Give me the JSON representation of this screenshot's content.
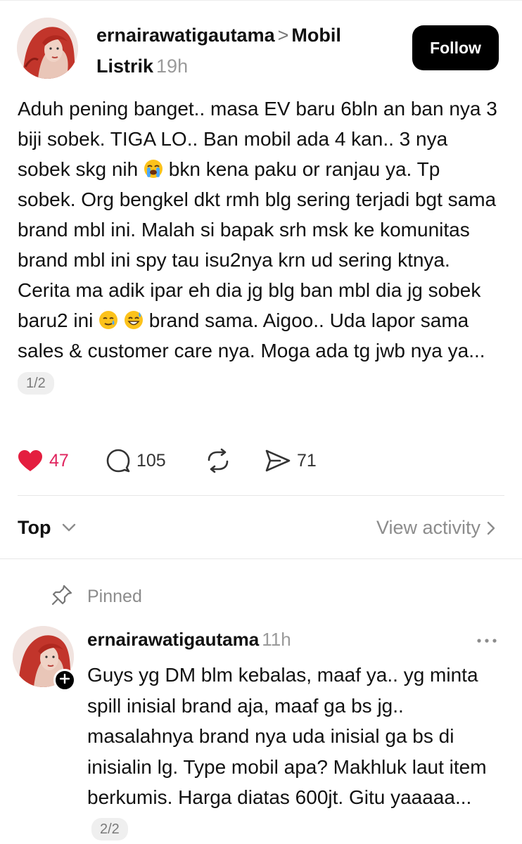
{
  "post": {
    "username": "ernairawatigautama",
    "separator": ">",
    "community": "Mobil Listrik",
    "time": "19h",
    "follow_label": "Follow",
    "body_parts": [
      "Aduh pening banget.. masa EV baru 6bln an ban nya 3 biji sobek. TIGA LO.. Ban mobil ada 4 kan.. 3 nya sobek skg nih ",
      " bkn kena paku or ranjau ya. Tp sobek. Org bengkel dkt rmh blg sering terjadi bgt sama brand mbl ini. Malah si bapak srh msk ke komunitas brand mbl ini spy tau isu2nya krn ud sering ktnya. Cerita ma adik ipar eh dia jg blg ban mbl dia jg sobek baru2 ini ",
      " brand sama. Aigoo.. Uda lapor sama sales & customer care nya. Moga ada tg jwb nya ya..."
    ],
    "emojis": [
      "loudly-crying-face",
      "smiling-face-with-tear",
      "grinning-face-with-sweat"
    ],
    "page_indicator": "1/2",
    "likes": "47",
    "replies": "105",
    "shares": "71",
    "liked": true
  },
  "sort": {
    "label": "Top",
    "view_activity": "View activity"
  },
  "pinned_comment": {
    "pinned_label": "Pinned",
    "username": "ernairawatigautama",
    "time": "11h",
    "body": "Guys yg DM blm kebalas, maaf ya.. yg minta spill inisial brand aja, maaf ga bs jg.. masalahnya brand nya uda inisial ga bs di inisialin lg. Type mobil apa? Makhluk laut item berkumis. Harga diatas 600jt. Gitu yaaaaa...",
    "page_indicator": "2/2"
  },
  "colors": {
    "like": "#e0245e",
    "muted": "#8c8c8c",
    "button_bg": "#000000"
  },
  "icons": [
    "heart-icon",
    "comment-icon",
    "repost-icon",
    "share-icon",
    "chevron-down-icon",
    "chevron-right-icon",
    "pin-icon",
    "more-icon",
    "plus-icon"
  ]
}
